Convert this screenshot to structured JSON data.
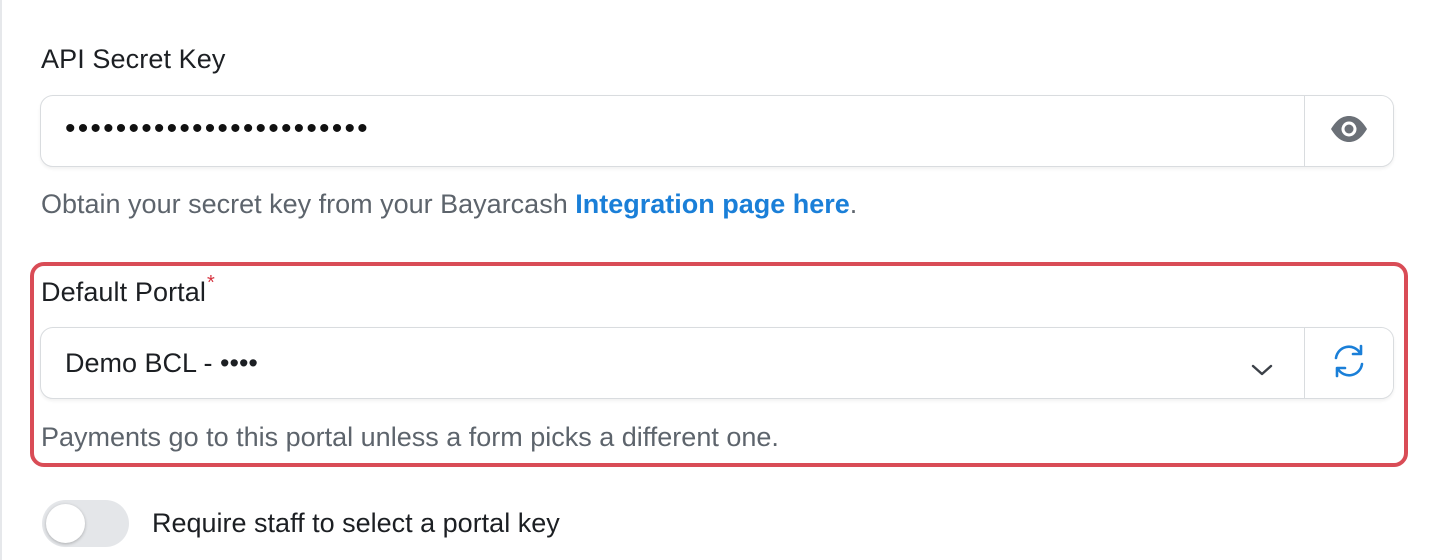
{
  "api_secret": {
    "label": "API Secret Key",
    "masked_value": "••••••••••••••••••••••••",
    "reveal_icon": "eye-icon",
    "help_prefix": "Obtain your secret key from your Bayarcash ",
    "help_link": "Integration page here",
    "help_suffix": "."
  },
  "default_portal": {
    "label": "Default Portal",
    "required_mark": "*",
    "selected_value": "Demo BCL - ••••",
    "dropdown_icon": "chevron-down-icon",
    "refresh_icon": "refresh-icon",
    "help": "Payments go to this portal unless a form picks a different one."
  },
  "require_staff": {
    "label": "Require staff to select a portal key",
    "enabled": false
  },
  "colors": {
    "link": "#1a7fd8",
    "highlight_border": "#d94c56",
    "required": "#d6333f",
    "refresh_icon": "#1a7fd8"
  }
}
